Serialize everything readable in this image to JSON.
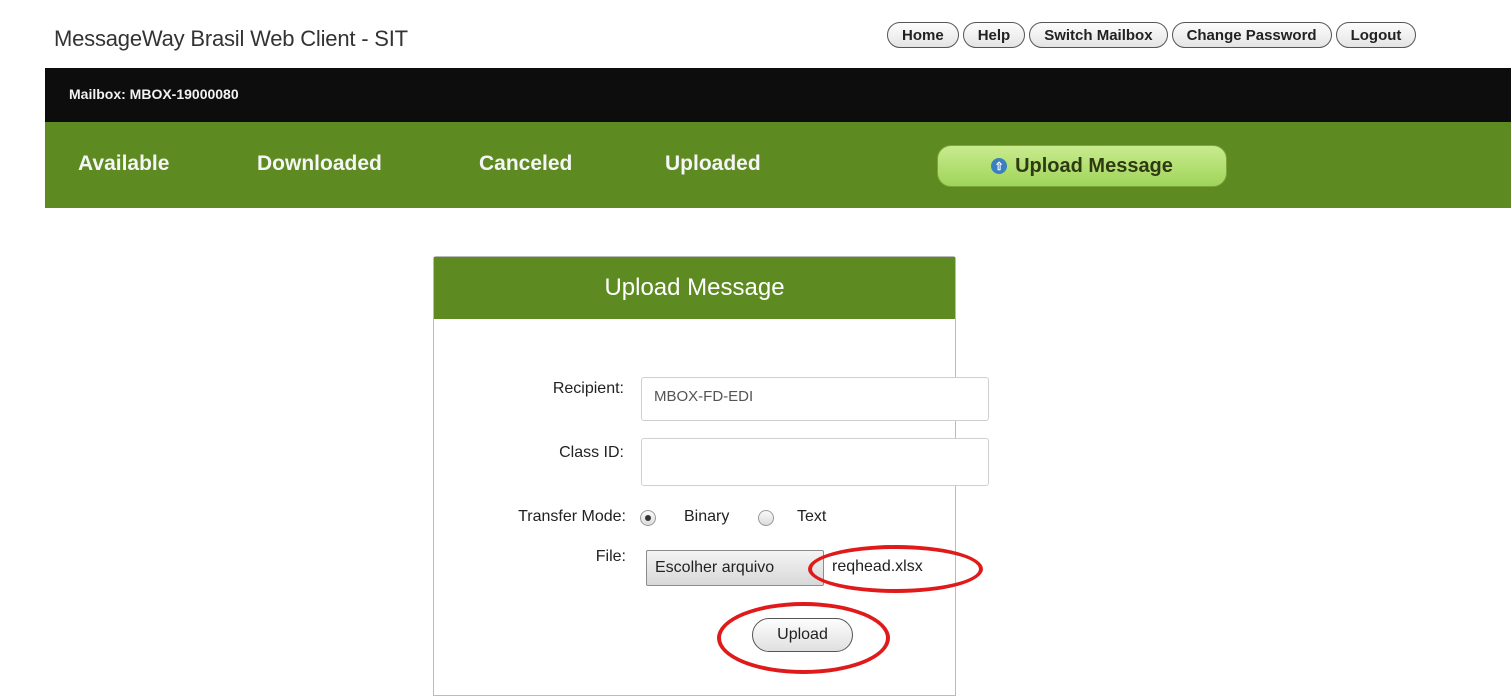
{
  "app": {
    "title": "MessageWay Brasil Web Client - SIT"
  },
  "top_nav": {
    "home": "Home",
    "help": "Help",
    "switch_mailbox": "Switch Mailbox",
    "change_password": "Change Password",
    "logout": "Logout"
  },
  "mailbox": {
    "label": "Mailbox: MBOX-19000080"
  },
  "tabs": {
    "available": "Available",
    "downloaded": "Downloaded",
    "canceled": "Canceled",
    "uploaded": "Uploaded",
    "upload_message": "Upload Message"
  },
  "form": {
    "title": "Upload Message",
    "recipient_label": "Recipient:",
    "recipient_value": "MBOX-FD-EDI",
    "class_id_label": "Class ID:",
    "class_id_value": "",
    "transfer_mode_label": "Transfer Mode:",
    "transfer_mode_options": [
      "Binary",
      "Text"
    ],
    "transfer_mode_selected": "Binary",
    "file_label": "File:",
    "file_button": "Escolher arquivo",
    "file_name": "reqhead.xlsx",
    "submit_label": "Upload"
  },
  "colors": {
    "nav_green": "#5e8a22",
    "annotation_red": "#e01a1a"
  },
  "icons": {
    "upload_icon": "upload-arrow-icon"
  }
}
